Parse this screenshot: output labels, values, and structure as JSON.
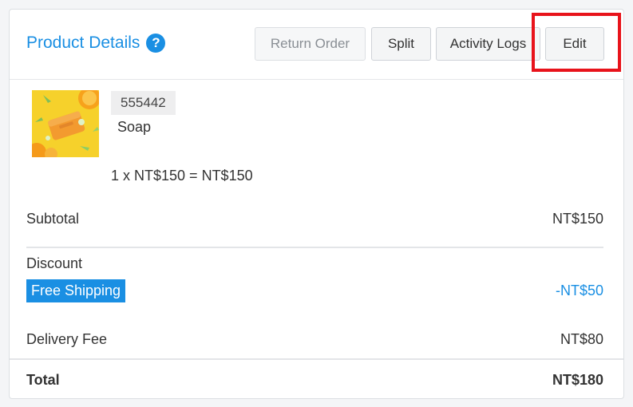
{
  "header": {
    "title": "Product Details",
    "help_icon": "question-circle-icon",
    "buttons": {
      "return_order": "Return Order",
      "split": "Split",
      "activity_logs": "Activity Logs",
      "edit": "Edit"
    }
  },
  "item": {
    "image_icon": "product-image",
    "sku": "555442",
    "name": "Soap",
    "formula": "1 x NT$150 = NT$150"
  },
  "summary": {
    "subtotal_label": "Subtotal",
    "subtotal_value": "NT$150",
    "discount_label": "Discount",
    "discount_tag": "Free Shipping",
    "discount_value": "-NT$50",
    "delivery_label": "Delivery Fee",
    "delivery_value": "NT$80",
    "total_label": "Total",
    "total_value": "NT$180"
  },
  "colors": {
    "accent": "#1a8fe3",
    "highlight": "#e8131b"
  }
}
